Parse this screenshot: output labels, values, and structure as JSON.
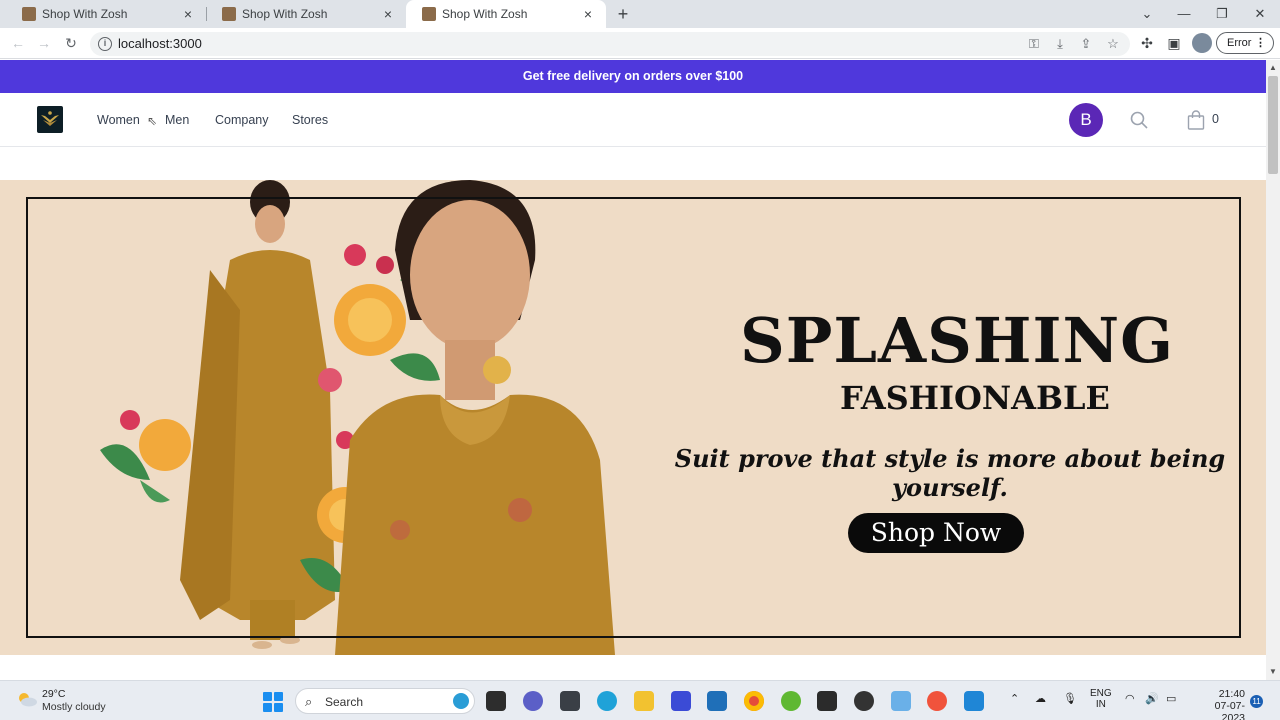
{
  "browser": {
    "tabs": [
      {
        "title": "Shop With Zosh",
        "active": false
      },
      {
        "title": "Shop With Zosh",
        "active": false
      },
      {
        "title": "Shop With Zosh",
        "active": true
      }
    ],
    "close_glyph": "×",
    "new_tab_glyph": "+",
    "url": "localhost:3000",
    "error_label": "Error"
  },
  "site": {
    "promo_text": "Get free delivery on orders over $100",
    "nav": [
      "Women",
      "Men",
      "Company",
      "Stores"
    ],
    "avatar_initial": "B",
    "cart_count": "0",
    "accent_color": "#4f38dc",
    "avatar_color": "#5b27b6"
  },
  "hero": {
    "heading_line1": "SPLASHING",
    "heading_line2": "FASHIONABLE",
    "tagline": "Suit prove that style is more about being yourself.",
    "cta_label": "Shop Now",
    "background_color": "#efdcc6"
  },
  "taskbar": {
    "temperature": "29°C",
    "weather": "Mostly cloudy",
    "search_label": "Search",
    "lang_line1": "ENG",
    "lang_line2": "IN",
    "time": "21:40",
    "date": "07-07-2023",
    "notification_count": "11"
  }
}
